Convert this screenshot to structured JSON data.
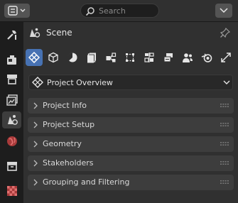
{
  "search": {
    "placeholder": "Search"
  },
  "context": {
    "label": "Scene"
  },
  "project_selector": {
    "value": "Project Overview"
  },
  "panels": [
    {
      "label": "Project Info"
    },
    {
      "label": "Project Setup"
    },
    {
      "label": "Geometry"
    },
    {
      "label": "Stakeholders"
    },
    {
      "label": "Grouping and Filtering"
    }
  ],
  "sidebar_tabs": [
    "tool-icon",
    "render-icon",
    "output-icon",
    "view-layer-icon",
    "scene-icon",
    "world-icon",
    "collection-icon",
    "texture-icon"
  ],
  "property_tabs": [
    "bim-project-icon",
    "bim-object-icon",
    "bim-geometry-icon",
    "bim-drawings-icon",
    "bim-services-icon",
    "bim-structural-icon",
    "bim-facility-icon",
    "bim-quality-icon",
    "bim-stakeholders-icon",
    "bim-blender-icon",
    "bim-other-icon"
  ],
  "colors": {
    "active_tab": "#4772b3",
    "panel_bg": "#3d3d3d",
    "editor_bg": "#303030"
  }
}
